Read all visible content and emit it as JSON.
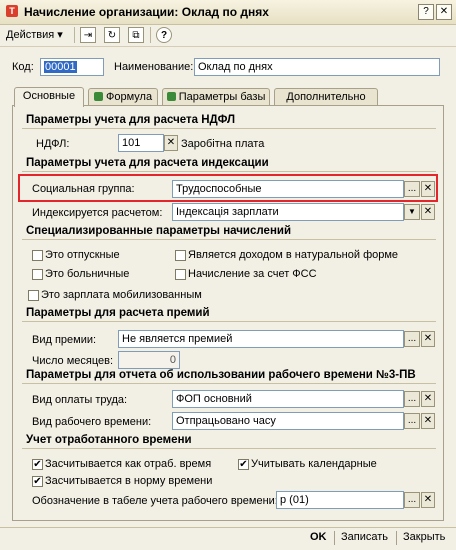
{
  "window": {
    "title": "Начисление организации: Оклад по днях",
    "icon_glyph": "Т"
  },
  "toolbar": {
    "actions_label": "Действия ▾"
  },
  "header": {
    "code_label": "Код:",
    "code_value": "00001",
    "name_label": "Наименование:",
    "name_value": "Оклад по днях"
  },
  "tabs": [
    {
      "label": "Основные",
      "active": true
    },
    {
      "label": "Формула",
      "active": false
    },
    {
      "label": "Параметры базы",
      "active": false
    },
    {
      "label": "Дополнительно",
      "active": false
    }
  ],
  "sections": {
    "ndfl": "Параметры учета для расчета НДФЛ",
    "indexation": "Параметры учета для расчета индексации",
    "special": "Специализированные параметры начислений",
    "bonus": "Параметры для расчета премий",
    "report": "Параметры для отчета об использовании рабочего времени №3-ПВ",
    "worktime": "Учет отработанного времени"
  },
  "ndfl": {
    "label": "НДФЛ:",
    "code": "101",
    "description": "Заробітна плата"
  },
  "indexation": {
    "social_group_label": "Социальная группа:",
    "social_group_value": "Трудоспособные",
    "indexed_by_label": "Индексируется расчетом:",
    "indexed_by_value": "Індексація зарплати"
  },
  "special": {
    "vacation": {
      "label": "Это отпускные",
      "checked": false
    },
    "in_kind": {
      "label": "Является доходом в натуральной форме",
      "checked": false
    },
    "sick": {
      "label": "Это больничные",
      "checked": false
    },
    "fss": {
      "label": "Начисление за счет ФСС",
      "checked": false
    },
    "mobilized": {
      "label": "Это зарплата мобилизованным",
      "checked": false
    }
  },
  "bonus": {
    "type_label": "Вид премии:",
    "type_value": "Не является премией",
    "months_label": "Число месяцев:",
    "months_value": "0"
  },
  "report": {
    "pay_type_label": "Вид оплаты труда:",
    "pay_type_value": "ФОП основний",
    "work_time_label": "Вид рабочего времени:",
    "work_time_value": "Отпрацьовано часу"
  },
  "worktime": {
    "counted_as_worked": {
      "label": "Засчитывается как отраб. время",
      "checked": true
    },
    "calendar": {
      "label": "Учитывать календарные",
      "checked": true
    },
    "counted_in_norm": {
      "label": "Засчитывается в норму времени",
      "checked": true
    },
    "designation_label": "Обозначение в табеле учета рабочего времени:",
    "designation_value": "р (01)"
  },
  "footer": {
    "ok": "OK",
    "save": "Записать",
    "close": "Закрыть"
  },
  "glyphs": {
    "check": "✔",
    "ellipsis": "...",
    "clear": "✕",
    "dropdown": "▼"
  },
  "colors": {
    "highlight": "#e3262b",
    "selection": "#316ac5"
  }
}
